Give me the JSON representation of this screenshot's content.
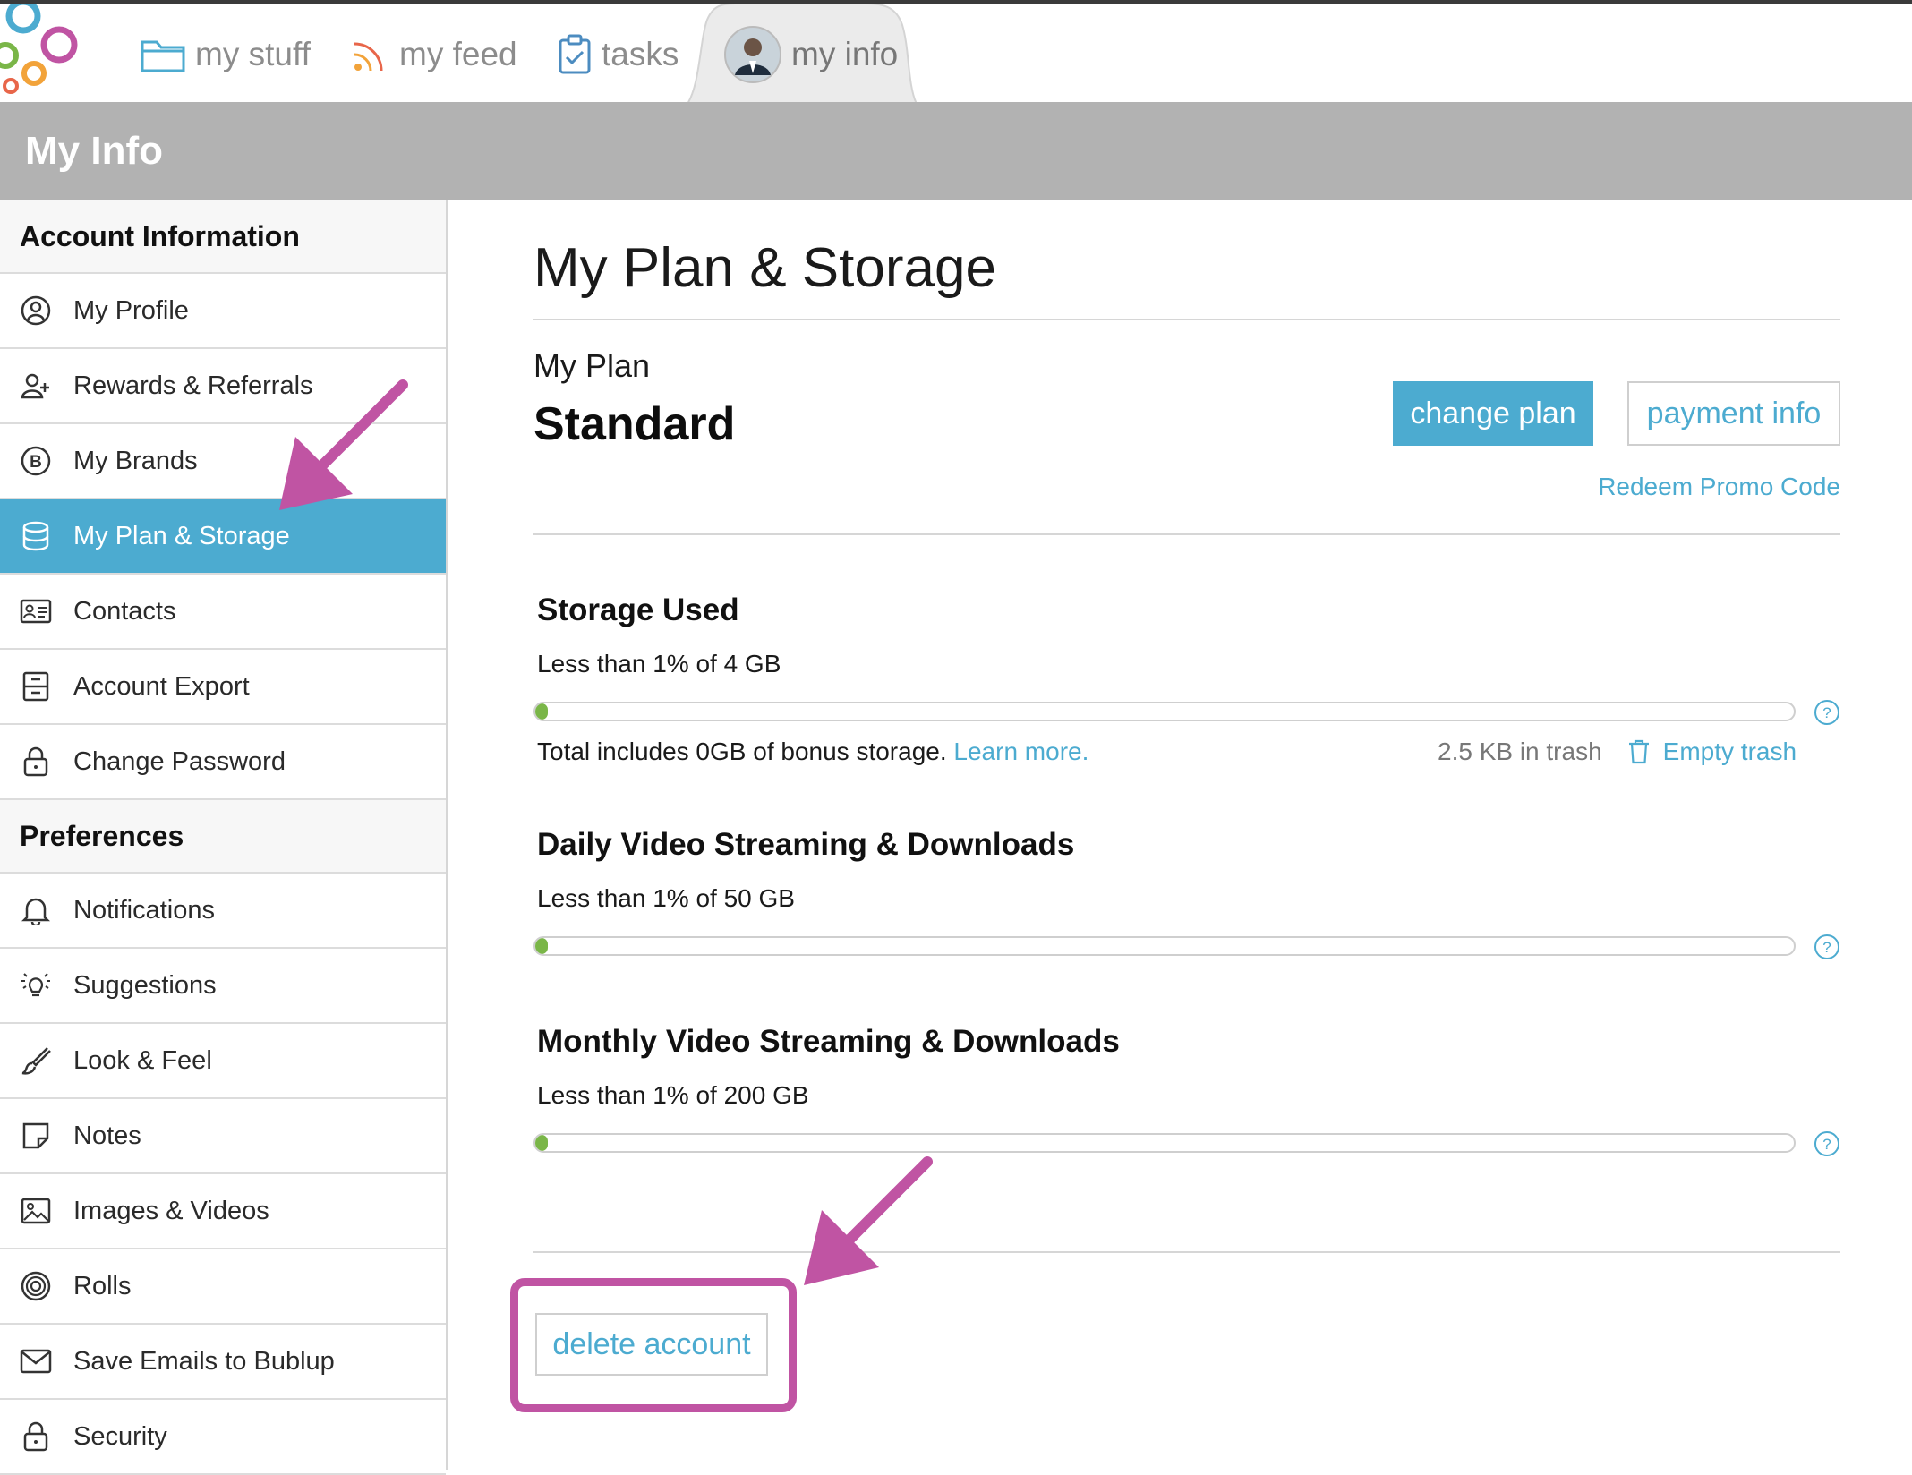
{
  "nav": {
    "items": [
      {
        "label": "my stuff",
        "icon": "folder-icon"
      },
      {
        "label": "my feed",
        "icon": "rss-icon"
      },
      {
        "label": "tasks",
        "icon": "clipboard-check-icon"
      },
      {
        "label": "my info",
        "icon": "avatar"
      }
    ]
  },
  "header": {
    "title": "My Info"
  },
  "sidebar": {
    "account_heading": "Account Information",
    "account_items": [
      {
        "label": "My Profile",
        "icon": "user-circle-icon"
      },
      {
        "label": "Rewards & Referrals",
        "icon": "add-user-icon"
      },
      {
        "label": "My Brands",
        "icon": "brand-b-icon"
      },
      {
        "label": "My Plan & Storage",
        "icon": "database-icon",
        "active": true
      },
      {
        "label": "Contacts",
        "icon": "contact-card-icon"
      },
      {
        "label": "Account Export",
        "icon": "export-drawer-icon"
      },
      {
        "label": "Change Password",
        "icon": "lock-icon"
      }
    ],
    "preferences_heading": "Preferences",
    "preference_items": [
      {
        "label": "Notifications",
        "icon": "bell-icon"
      },
      {
        "label": "Suggestions",
        "icon": "lightbulb-icon"
      },
      {
        "label": "Look & Feel",
        "icon": "paintbrush-icon"
      },
      {
        "label": "Notes",
        "icon": "note-icon"
      },
      {
        "label": "Images & Videos",
        "icon": "image-icon"
      },
      {
        "label": "Rolls",
        "icon": "spiral-icon"
      },
      {
        "label": "Save Emails to Bublup",
        "icon": "envelope-icon"
      },
      {
        "label": "Security",
        "icon": "lock-icon"
      }
    ]
  },
  "main": {
    "title": "My Plan & Storage",
    "plan_label": "My Plan",
    "plan_name": "Standard",
    "change_plan": "change plan",
    "payment_info": "payment info",
    "promo": "Redeem Promo Code",
    "storage": {
      "title": "Storage Used",
      "usage": "Less than 1% of 4 GB",
      "fill_fraction": 0.01,
      "note": "Total includes 0GB of bonus storage.",
      "learn_more": "Learn more.",
      "trash": "2.5 KB in trash",
      "empty_trash": "Empty trash"
    },
    "daily": {
      "title": "Daily Video Streaming & Downloads",
      "usage": "Less than 1% of 50 GB",
      "fill_fraction": 0.01
    },
    "monthly": {
      "title": "Monthly Video Streaming & Downloads",
      "usage": "Less than 1% of 200 GB",
      "fill_fraction": 0.01
    },
    "delete_account": "delete account"
  },
  "colors": {
    "accent": "#4cabd0",
    "annotation": "#c054a3",
    "progress": "#7ab648",
    "header": "#b2b2b2"
  }
}
